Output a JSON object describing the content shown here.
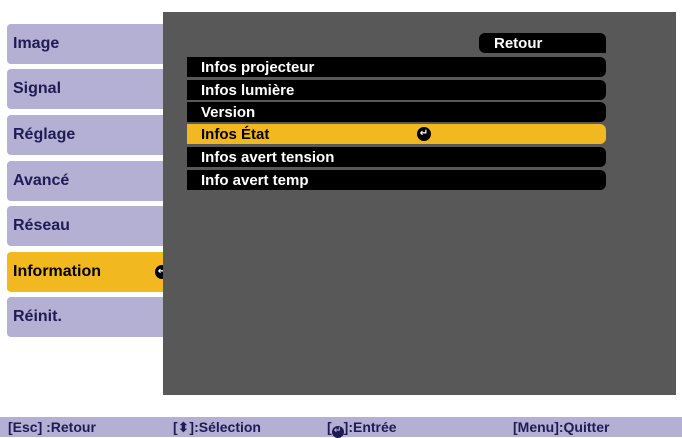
{
  "sidebar": {
    "items": [
      {
        "label": "Image"
      },
      {
        "label": "Signal"
      },
      {
        "label": "Réglage"
      },
      {
        "label": "Avancé"
      },
      {
        "label": "Réseau"
      },
      {
        "label": "Information",
        "selected": true
      },
      {
        "label": "Réinit."
      }
    ]
  },
  "main": {
    "back_label": "Retour",
    "items": [
      {
        "label": "Infos projecteur"
      },
      {
        "label": "Infos lumière"
      },
      {
        "label": "Version"
      },
      {
        "label": "Infos État",
        "selected": true
      },
      {
        "label": "Infos avert tension"
      },
      {
        "label": "Info avert temp"
      }
    ]
  },
  "help_bar": {
    "esc": "[Esc] :Retour",
    "select_open": "[",
    "select_rest": "]:Sélection",
    "enter_open": "[",
    "enter_rest": "]:Entrée",
    "quit": "[Menu]:Quitter"
  },
  "icons": {
    "enter": "enter-icon",
    "arrows": "up-down-arrows-icon"
  },
  "colors": {
    "sidebar_bg": "#b3b0d3",
    "selected_bg": "#f2b81f",
    "panel_bg": "#585858",
    "row_bg": "#000000"
  }
}
